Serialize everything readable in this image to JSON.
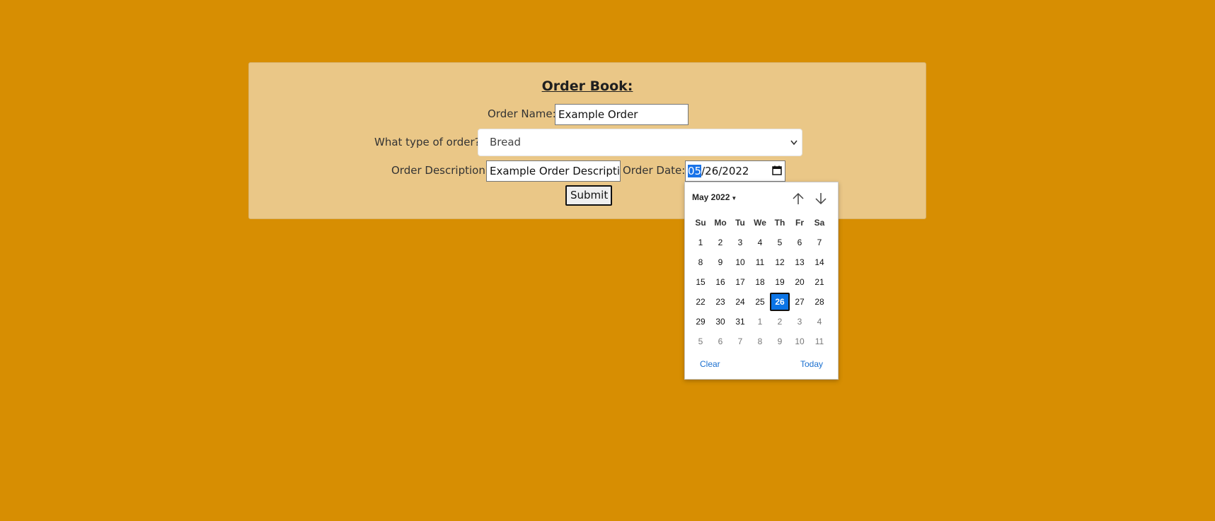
{
  "form": {
    "title": "Order Book:",
    "name_label": "Order Name:",
    "name_value": "Example Order",
    "type_label": "What type of order?",
    "type_selected": "Bread",
    "desc_label": "Order Description:",
    "desc_value": "Example Order Descriptio",
    "date_label": "Order Date:",
    "date_month": "05",
    "date_rest": "/26/2022",
    "submit_label": "Submit"
  },
  "datepicker": {
    "month_label": "May 2022",
    "weekdays": [
      "Su",
      "Mo",
      "Tu",
      "We",
      "Th",
      "Fr",
      "Sa"
    ],
    "weeks": [
      [
        "1",
        "2",
        "3",
        "4",
        "5",
        "6",
        "7"
      ],
      [
        "8",
        "9",
        "10",
        "11",
        "12",
        "13",
        "14"
      ],
      [
        "15",
        "16",
        "17",
        "18",
        "19",
        "20",
        "21"
      ],
      [
        "22",
        "23",
        "24",
        "25",
        "26",
        "27",
        "28"
      ],
      [
        "29",
        "30",
        "31",
        "1",
        "2",
        "3",
        "4"
      ],
      [
        "5",
        "6",
        "7",
        "8",
        "9",
        "10",
        "11"
      ]
    ],
    "selected_day": "26",
    "clear_label": "Clear",
    "today_label": "Today"
  },
  "colors": {
    "page_background": "#d78e02",
    "panel_background": "#eac787",
    "selected_day": "#0b74e5"
  },
  "icons": {
    "calendar": "calendar-icon",
    "prev_month": "arrow-up-icon",
    "next_month": "arrow-down-icon",
    "dropdown": "chevron-down-icon"
  }
}
